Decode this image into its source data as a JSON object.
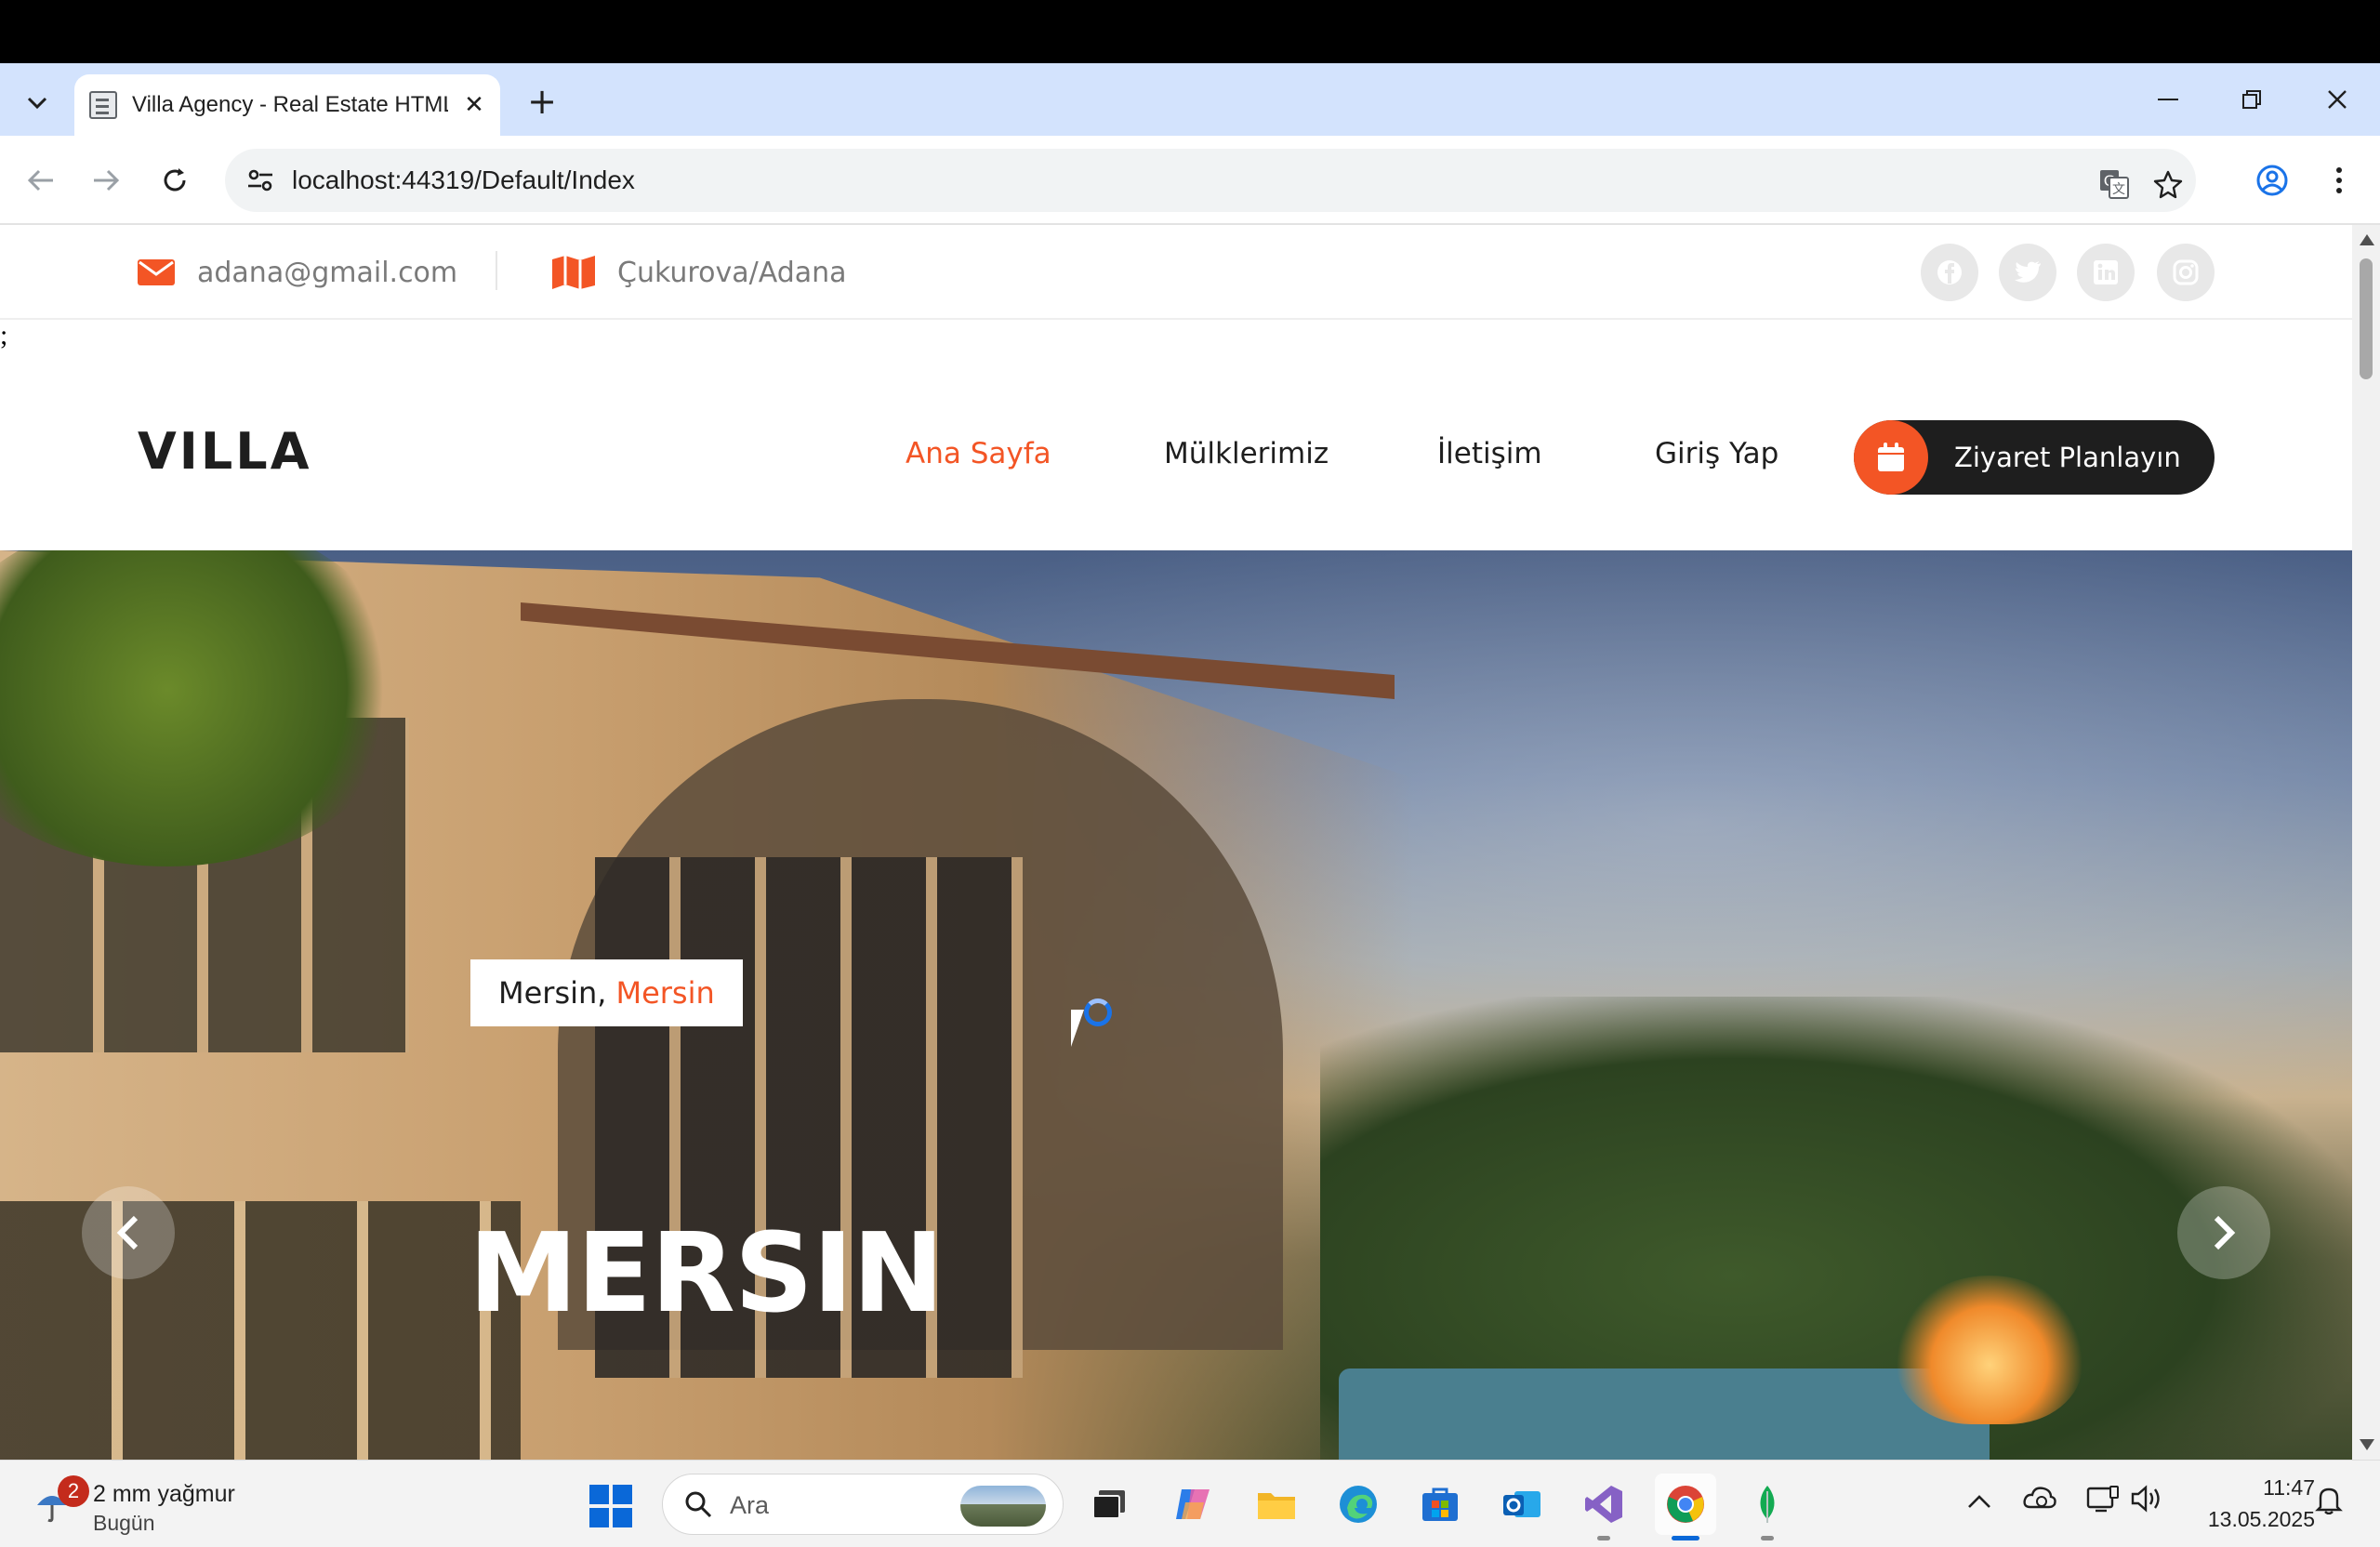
{
  "browser": {
    "tab_title": "Villa Agency - Real Estate HTML",
    "tab_close": "✕",
    "new_tab": "+",
    "url": "localhost:44319/Default/Index"
  },
  "topbar": {
    "email": "adana@gmail.com",
    "location": "Çukurova/Adana",
    "social": [
      "facebook-icon",
      "twitter-icon",
      "linkedin-icon",
      "instagram-icon"
    ]
  },
  "stray_text": ";",
  "header": {
    "logo": "VILLA",
    "nav": [
      "Ana Sayfa",
      "Mülklerimiz",
      "İletişim",
      "Giriş Yap"
    ],
    "active_nav": "Ana Sayfa",
    "cta_label": "Ziyaret Planlayın"
  },
  "hero": {
    "badge_city": "Mersin,",
    "badge_accent": "Mersin",
    "title": "MERSIN"
  },
  "taskbar": {
    "weather_badge": "2",
    "weather_main": "2 mm yağmur",
    "weather_sub": "Bugün",
    "search_label": "Ara",
    "time": "11:47",
    "date": "13.05.2025"
  },
  "colors": {
    "accent": "#f35525",
    "dark": "#1e1e1e",
    "tabstrip": "#d3e3fd"
  }
}
